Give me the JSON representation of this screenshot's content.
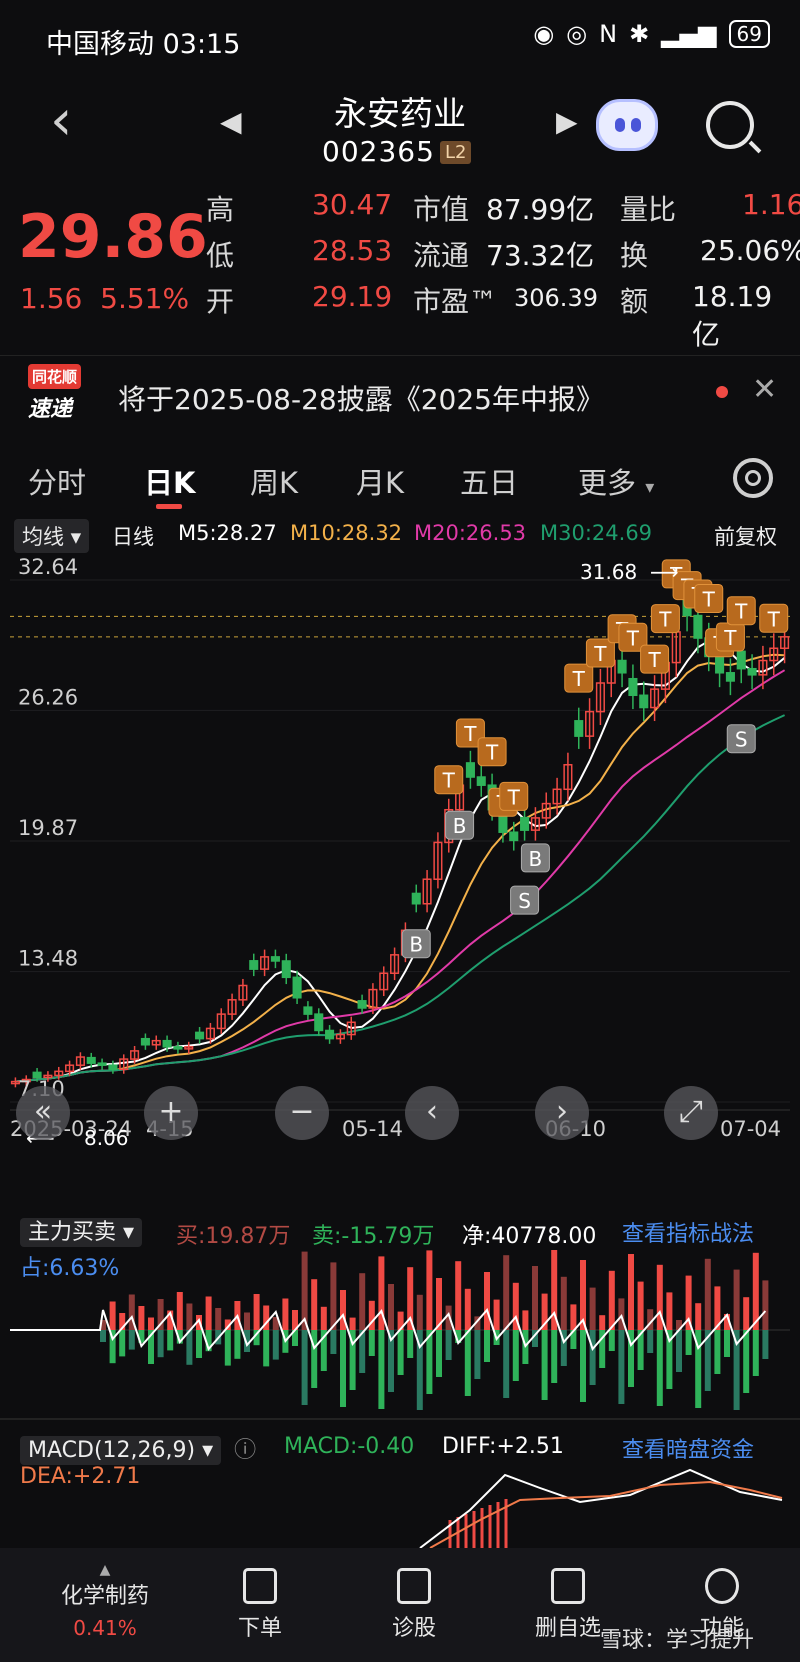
{
  "status_bar": {
    "carrier_time": "中国移动 03:15",
    "battery": "69"
  },
  "header": {
    "stock_name": "永安药业",
    "stock_code": "002365",
    "level": "L2"
  },
  "quote": {
    "price": "29.86",
    "change": "1.56",
    "change_pct": "5.51%",
    "high_label": "高",
    "high": "30.47",
    "low_label": "低",
    "low": "28.53",
    "open_label": "开",
    "open": "29.19",
    "mktcap_label": "市值",
    "mktcap": "87.99亿",
    "float_label": "流通",
    "float": "73.32亿",
    "pe_label": "市盈™",
    "pe": "306.39",
    "vol_ratio_label": "量比",
    "vol_ratio": "1.16",
    "turnover_label": "换",
    "turnover": "25.06%",
    "amount_label": "额",
    "amount": "18.19亿"
  },
  "notice": {
    "logo_top": "同花顺",
    "logo_bottom": "速递",
    "text": "将于2025-08-28披露《2025年中报》"
  },
  "tabs": [
    "分时",
    "日K",
    "周K",
    "月K",
    "五日",
    "更多"
  ],
  "ma_legend": {
    "selector": "均线",
    "period": "日线",
    "m5": "M5:28.27",
    "m10": "M10:28.32",
    "m20": "M20:26.53",
    "m30": "M30:24.69",
    "adjust": "前复权",
    "colors": {
      "m5": "#ffffff",
      "m10": "#f3b14a",
      "m20": "#e03aa8",
      "m30": "#1f9e6e"
    }
  },
  "chart_data": {
    "type": "candlestick",
    "y_labels": [
      "32.64",
      "26.26",
      "19.87",
      "13.48",
      "7.10"
    ],
    "high_mark": "31.68",
    "low_mark": "8.06",
    "x_labels": [
      "2025-03-24",
      "4-15",
      "05-14",
      "06-10",
      "07-04"
    ],
    "closes": [
      8.1,
      8.2,
      8.3,
      8.4,
      8.6,
      8.9,
      9.3,
      9.0,
      8.9,
      8.7,
      9.2,
      9.6,
      9.9,
      10.1,
      9.8,
      9.7,
      9.8,
      10.2,
      10.7,
      11.4,
      12.1,
      12.8,
      13.6,
      14.2,
      14.0,
      13.2,
      12.2,
      11.4,
      10.6,
      10.2,
      10.4,
      11.0,
      11.7,
      12.6,
      13.4,
      14.3,
      15.5,
      16.8,
      18.0,
      19.8,
      21.4,
      22.6,
      23.0,
      22.6,
      21.4,
      20.3,
      19.9,
      20.4,
      21.0,
      21.7,
      22.4,
      23.6,
      25.0,
      26.2,
      27.6,
      28.7,
      28.1,
      27.0,
      26.4,
      27.3,
      28.6,
      30.1,
      30.9,
      29.8,
      28.9,
      28.1,
      27.7,
      28.3,
      28.0,
      28.7,
      29.3,
      29.86
    ],
    "markers": {
      "T": [
        "T",
        "T",
        "T",
        "T",
        "T",
        "T",
        "T",
        "T",
        "T",
        "T",
        "T",
        "T",
        "T",
        "T",
        "T",
        "T",
        "T",
        "T",
        "T"
      ],
      "B": [
        "B",
        "B",
        "B"
      ],
      "S": [
        "S",
        "S"
      ]
    }
  },
  "zoom_controls": [
    "«",
    "+",
    "−",
    "‹",
    "›",
    "⤢"
  ],
  "main_force": {
    "selector": "主力买卖",
    "buy": "买:19.87万",
    "sell": "卖:-15.79万",
    "net": "净:40778.00",
    "link": "查看指标战法",
    "pct": "占:6.63%"
  },
  "macd": {
    "selector": "MACD(12,26,9)",
    "macd": "MACD:-0.40",
    "diff": "DIFF:+2.51",
    "link": "查看暗盘资金",
    "dea": "DEA:+2.71"
  },
  "bottom_bar": {
    "sector": "化学制药",
    "sector_pct": "0.41%",
    "items": [
      "下单",
      "诊股",
      "删自选",
      "功能"
    ],
    "watermark": "雪球：学习提升"
  }
}
